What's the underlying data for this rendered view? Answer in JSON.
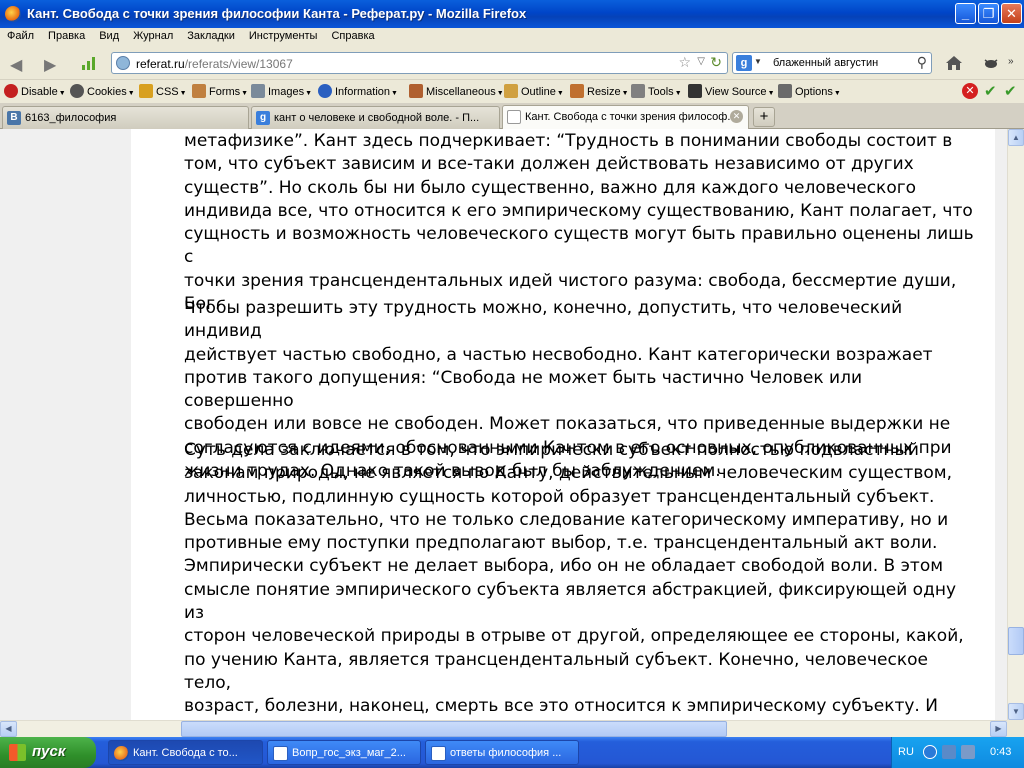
{
  "window": {
    "title": "Кант. Свобода с точки зрения философии Канта - Реферат.ру - Mozilla Firefox",
    "min": "_",
    "max": "❐",
    "close": "✕"
  },
  "menu": [
    "Файл",
    "Правка",
    "Вид",
    "Журнал",
    "Закладки",
    "Инструменты",
    "Справка"
  ],
  "nav": {
    "back": "◀",
    "forward": "▶",
    "url_host": "referat.ru",
    "url_path": "/referats/view/13067",
    "search_engine": "g",
    "search_query": "блаженный августин"
  },
  "devbar": [
    {
      "label": "Disable",
      "icon": "disable-icon",
      "color": "#c42020"
    },
    {
      "label": "Cookies",
      "icon": "cookies-icon",
      "color": "#555555"
    },
    {
      "label": "CSS",
      "icon": "css-icon",
      "color": "#d8a020"
    },
    {
      "label": "Forms",
      "icon": "forms-icon",
      "color": "#c08040"
    },
    {
      "label": "Images",
      "icon": "images-icon",
      "color": "#7a8a9a"
    },
    {
      "label": "Information",
      "icon": "information-icon",
      "color": "#2a5fc0"
    },
    {
      "label": "Miscellaneous",
      "icon": "miscellaneous-icon",
      "color": "#b06030"
    },
    {
      "label": "Outline",
      "icon": "outline-icon",
      "color": "#d0a040"
    },
    {
      "label": "Resize",
      "icon": "resize-icon",
      "color": "#c07030"
    },
    {
      "label": "Tools",
      "icon": "tools-icon",
      "color": "#808080"
    },
    {
      "label": "View Source",
      "icon": "view-source-icon",
      "color": "#333333"
    },
    {
      "label": "Options",
      "icon": "options-icon",
      "color": "#6a6a6a"
    }
  ],
  "tabs": [
    {
      "label": "6163_философия",
      "icon_text": "В",
      "icon_color": "#4a76a8",
      "active": false
    },
    {
      "label": "кант о человеке и свободной воле. - П...",
      "icon_text": "g",
      "icon_color": "#3a7fdc",
      "active": false
    },
    {
      "label": "Кант. Свобода с точки зрения философ...",
      "icon_text": "",
      "icon_color": "#ffffff",
      "active": true
    }
  ],
  "new_tab": "+",
  "article": {
    "p1": "метафизике”. Кант здесь подчеркивает: “Трудность  в понимании свободы  состоит  в\nтом, что субъект зависим  и все-таки должен действовать   независимо от других\nсуществ”. Но сколь бы ни было существенно, важно для каждого человеческого\nиндивида все, что относится к его эмпирическому существованию, Кант полагает, что\nсущность и возможность человеческого существ могут быть правильно оценены лишь с\nточки зрения трансцендентальных идей чистого разума: свобода, бессмертие души,\nБог.",
    "p2": "Чтобы разрешить эту трудность можно, конечно, допустить, что человеческий индивид\nдействует частью свободно, а частью несвободно. Кант категорически возражает\nпротив такого допущения: “Свобода не может быть частично Человек или совершенно\nсвободен или вовсе не свободен. Может показаться, что приведенные выдержки не\nсогласуются с идеями, обоснованными Кантом в его основных, опубликованных при\nжизни трудах. Однако такой вывод был бы заблуждением.",
    "p3": "      Суть дела заключается в том, что эмпирически  субъект полностью подвластный\nзаконам природы, не является по Канту, действительным человеческим существом,\nличностью, подлинную сущность которой образует трансцендентальный субъект.\nВесьма показательно, что не только следование категорическому императиву, но и\nпротивные ему поступки предполагают выбор, т.е.  трансцендентальный акт воли.\nЭмпирически субъект не делает выбора, ибо он не обладает свободой воли. В этом\nсмысле понятие эмпирического субъекта является абстракцией, фиксирующей  одну из\nсторон человеческой природы  в отрыве от другой, определяющее ее стороны, какой,\nпо учению Канта, является трансцендентальный субъект. Конечно, человеческое тело,\nвозраст, болезни, наконец, смерть  все это относится к эмпирическому субъекту. И\nКант вовсе не игнорирует бренность индивидуального человеческого существования,\nанализу которого в значительной своей части посвящена его Антропология."
  },
  "taskbar": {
    "start": "пуск",
    "tasks": [
      {
        "label": "Кант. Свобода с то...",
        "icon_color": "#e87020",
        "active": true
      },
      {
        "label": "Вопр_гос_экз_маг_2...",
        "icon_color": "#2a5fc0",
        "active": false
      },
      {
        "label": "ответы философия ...",
        "icon_color": "#2a5fc0",
        "active": false
      }
    ],
    "lang": "RU",
    "clock": "0:43"
  }
}
